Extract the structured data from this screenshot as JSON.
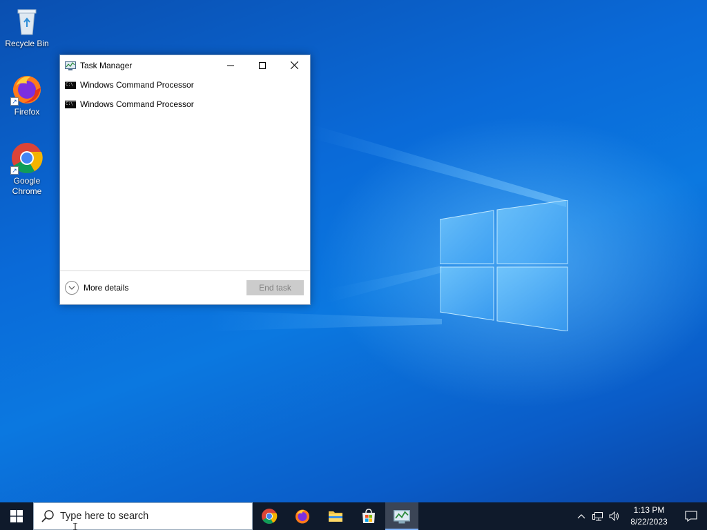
{
  "desktop": {
    "icons": [
      {
        "label": "Recycle Bin",
        "icon": "recycle-bin-icon"
      },
      {
        "label": "Firefox",
        "icon": "firefox-icon"
      },
      {
        "label": "Google Chrome",
        "icon": "chrome-icon"
      }
    ]
  },
  "task_manager": {
    "title": "Task Manager",
    "processes": [
      {
        "name": "Windows Command Processor",
        "icon": "cmd-icon"
      },
      {
        "name": "Windows Command Processor",
        "icon": "cmd-icon"
      }
    ],
    "more_details_label": "More details",
    "end_task_label": "End task"
  },
  "taskbar": {
    "search_placeholder": "Type here to search",
    "pinned_apps": [
      "chrome-icon",
      "firefox-icon",
      "file-explorer-icon",
      "store-icon",
      "task-manager-icon"
    ],
    "active_app": "task-manager-icon",
    "clock": {
      "time": "1:13 PM",
      "date": "8/22/2023"
    }
  },
  "colors": {
    "taskbar_bg": "#0f1a2b",
    "desktop_blue": "#0a6ad8",
    "active_indicator": "#7fb4ff"
  }
}
